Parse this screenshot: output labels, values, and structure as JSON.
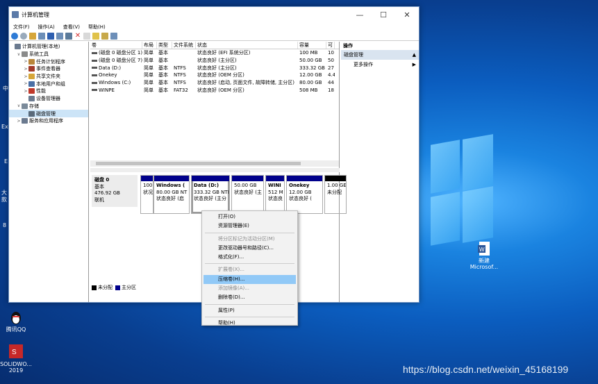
{
  "window": {
    "title": "计算机管理",
    "min": "—",
    "max": "☐",
    "close": "✕"
  },
  "menu": [
    "文件(F)",
    "操作(A)",
    "查看(V)",
    "帮助(H)"
  ],
  "tree": [
    {
      "label": "计算机管理(本地)",
      "arrow": "",
      "indent": 0,
      "color": "#6b7a8f"
    },
    {
      "label": "系统工具",
      "arrow": "∨",
      "indent": 1,
      "color": "#8a8a8a"
    },
    {
      "label": "任务计划程序",
      "arrow": ">",
      "indent": 2,
      "color": "#b9863a"
    },
    {
      "label": "事件查看器",
      "arrow": ">",
      "indent": 2,
      "color": "#a33a2a"
    },
    {
      "label": "共享文件夹",
      "arrow": ">",
      "indent": 2,
      "color": "#d6a63a"
    },
    {
      "label": "本地用户和组",
      "arrow": ">",
      "indent": 2,
      "color": "#4a6fa5"
    },
    {
      "label": "性能",
      "arrow": ">",
      "indent": 2,
      "color": "#c0392b"
    },
    {
      "label": "设备管理器",
      "arrow": "",
      "indent": 2,
      "color": "#6b7a8f"
    },
    {
      "label": "存储",
      "arrow": "∨",
      "indent": 1,
      "color": "#7a8a9a"
    },
    {
      "label": "磁盘管理",
      "arrow": "",
      "indent": 2,
      "color": "#5a6a7a",
      "selected": true
    },
    {
      "label": "服务和应用程序",
      "arrow": ">",
      "indent": 1,
      "color": "#6b7a8f"
    }
  ],
  "volumes": {
    "headers": [
      "卷",
      "布局",
      "类型",
      "文件系统",
      "状态",
      "容量",
      "可"
    ],
    "rows": [
      [
        "(磁盘 0 磁盘分区 1)",
        "简单",
        "基本",
        "",
        "状态良好 (EFI 系统分区)",
        "100 MB",
        "10"
      ],
      [
        "(磁盘 0 磁盘分区 7)",
        "简单",
        "基本",
        "",
        "状态良好 (主分区)",
        "50.00 GB",
        "50"
      ],
      [
        "Data (D:)",
        "简单",
        "基本",
        "NTFS",
        "状态良好 (主分区)",
        "333.32 GB",
        "27"
      ],
      [
        "Onekey",
        "简单",
        "基本",
        "NTFS",
        "状态良好 (OEM 分区)",
        "12.00 GB",
        "4.4"
      ],
      [
        "Windows (C:)",
        "简单",
        "基本",
        "NTFS",
        "状态良好 (启动, 页面文件, 故障转储, 主分区)",
        "80.00 GB",
        "44"
      ],
      [
        "WINPE",
        "简单",
        "基本",
        "FAT32",
        "状态良好 (OEM 分区)",
        "508 MB",
        "18"
      ]
    ]
  },
  "disk": {
    "name": "磁盘 0",
    "type": "基本",
    "size": "476.92 GB",
    "status": "联机",
    "partitions": [
      {
        "name": "",
        "size": "100",
        "status": "状况"
      },
      {
        "name": "Windows (",
        "size": "80.00 GB NT",
        "status": "状态良好 (启"
      },
      {
        "name": "Data (D:)",
        "size": "333.32 GB NTI",
        "status": "状态良好 (主分"
      },
      {
        "name": "",
        "size": "50.00 GB",
        "status": "状态良好 (主"
      },
      {
        "name": "WINI",
        "size": "512 M",
        "status": "状态良"
      },
      {
        "name": "Onekey",
        "size": "12.00 GB",
        "status": "状态良好 ("
      },
      {
        "name": "",
        "size": "1.00 GE",
        "status": "未分配"
      }
    ]
  },
  "legend": {
    "unalloc": "未分配",
    "primary": "主分区"
  },
  "ops": {
    "header": "操作",
    "section": "磁盘管理",
    "more": "更多操作",
    "up": "▲",
    "right": "▶"
  },
  "context_menu": [
    {
      "label": "打开(O)",
      "state": "normal"
    },
    {
      "label": "资源管理器(E)",
      "state": "normal"
    },
    {
      "sep": true
    },
    {
      "label": "将分区标记为活动分区(M)",
      "state": "disabled"
    },
    {
      "label": "更改驱动器号和路径(C)...",
      "state": "normal"
    },
    {
      "label": "格式化(F)...",
      "state": "normal"
    },
    {
      "sep": true
    },
    {
      "label": "扩展卷(X)...",
      "state": "disabled"
    },
    {
      "label": "压缩卷(H)...",
      "state": "highlighted"
    },
    {
      "label": "添加镜像(A)...",
      "state": "disabled"
    },
    {
      "label": "删除卷(D)...",
      "state": "normal"
    },
    {
      "sep": true
    },
    {
      "label": "属性(P)",
      "state": "normal"
    },
    {
      "sep": true
    },
    {
      "label": "帮助(H)",
      "state": "normal"
    }
  ],
  "desktop": {
    "icon1": "腾讯QQ",
    "icon2a": "SOLIDWO...",
    "icon2b": "2019",
    "icon3a": "新建",
    "icon3b": "Microsof...",
    "watermark": "https://blog.csdn.net/weixin_45168199"
  }
}
